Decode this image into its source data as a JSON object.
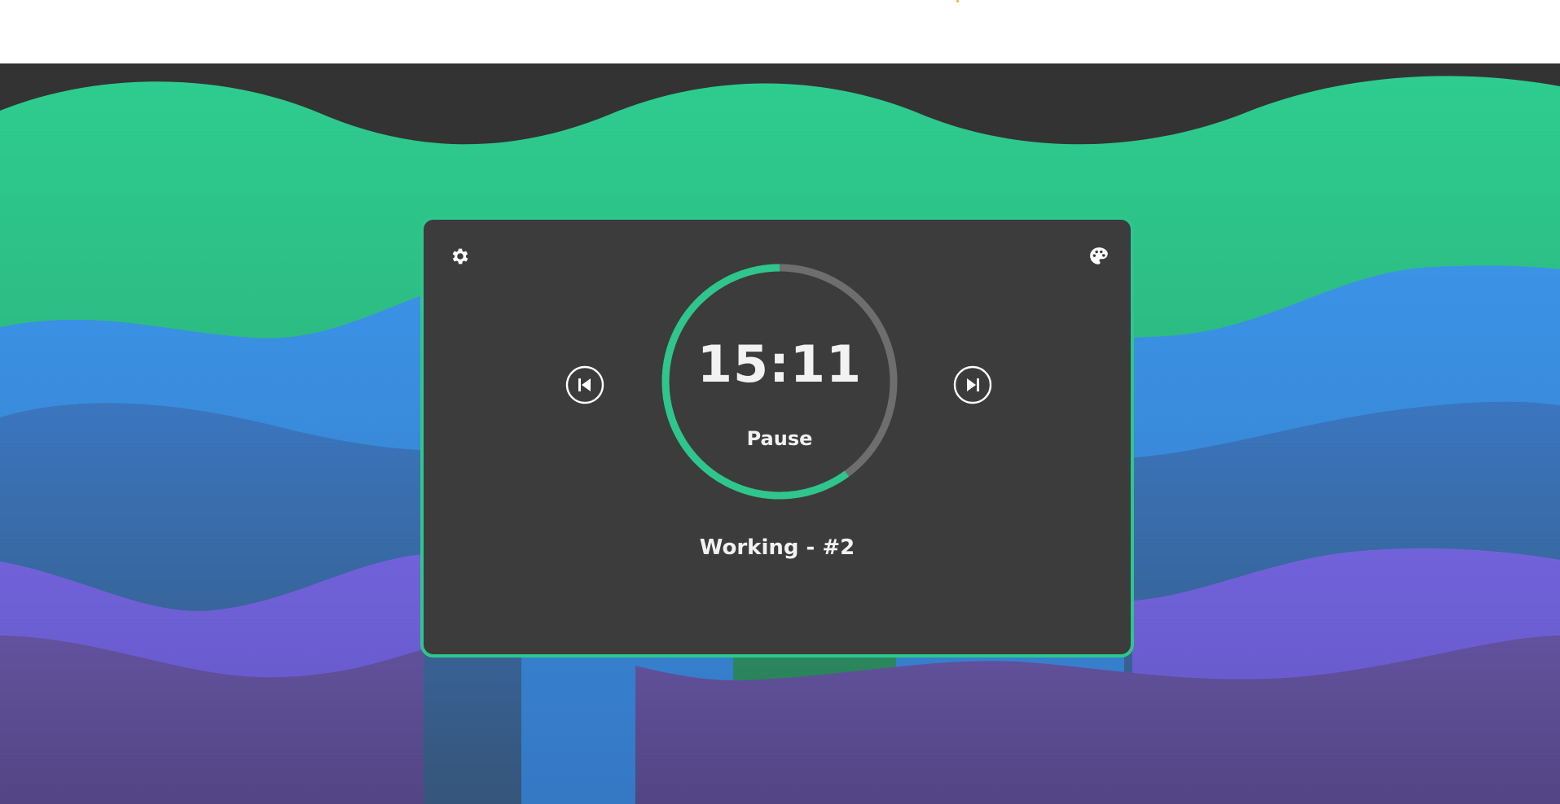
{
  "timer": {
    "time": "15:11",
    "progress": 0.6,
    "pause_label": "Pause"
  },
  "session": {
    "label": "Working - #2"
  },
  "icons": {
    "settings": "gear-icon",
    "theme": "palette-icon",
    "previous": "skip-previous-icon",
    "next": "skip-next-icon"
  },
  "colors": {
    "accent": "#2ec68c",
    "card_background": "#3c3c3c",
    "page_background": "#333333",
    "ring_track": "#6e6e6e",
    "text": "#f2f2f2",
    "wave_green": "#2ec68c",
    "wave_blue": "#3b8fe0",
    "wave_purple": "#6d5fd4"
  }
}
